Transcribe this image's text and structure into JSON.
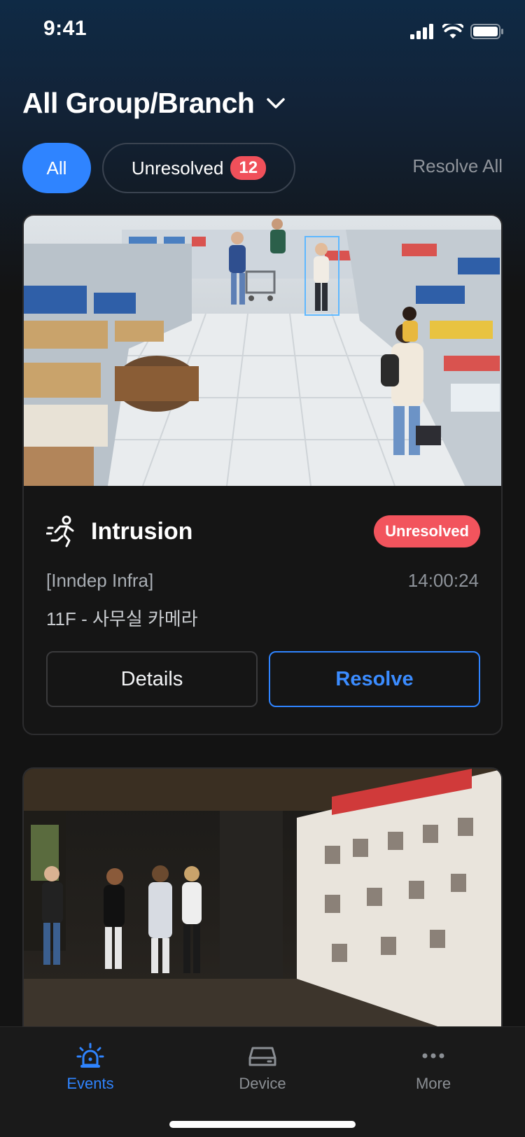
{
  "status_bar": {
    "time": "9:41"
  },
  "header": {
    "title": "All Group/Branch"
  },
  "filters": {
    "all_label": "All",
    "unresolved_label": "Unresolved",
    "unresolved_count": "12",
    "resolve_all_label": "Resolve All"
  },
  "events": [
    {
      "type": "Intrusion",
      "status": "Unresolved",
      "organization": "[Inndep Infra]",
      "time": "14:00:24",
      "location": "11F - 사무실 카메라",
      "details_label": "Details",
      "resolve_label": "Resolve"
    }
  ],
  "tabbar": {
    "events_label": "Events",
    "device_label": "Device",
    "more_label": "More"
  },
  "colors": {
    "accent": "#2f84ff",
    "danger": "#f2545d",
    "background": "#131313"
  }
}
